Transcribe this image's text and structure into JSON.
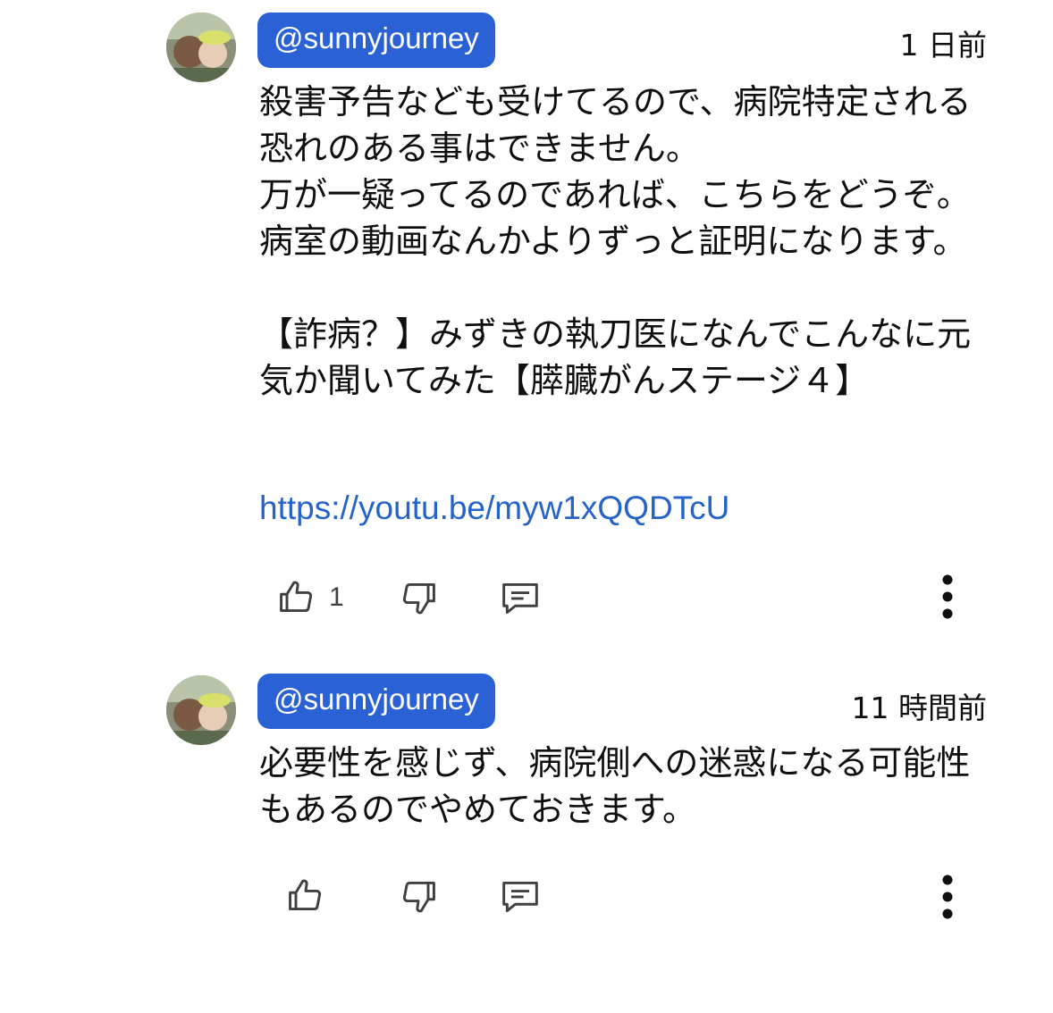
{
  "comments": [
    {
      "author": "@sunnyjourney",
      "time": "1 日前",
      "text": "殺害予告なども受けてるので、病院特定される恐れのある事はできません。\n万が一疑ってるのであれば、こちらをどうぞ。病室の動画なんかよりずっと証明になります。\n\n【詐病？】みずきの執刀医になんでこんなに元気か聞いてみた【膵臓がんステージ４】",
      "link": "https://youtu.be/myw1xQQDTcU",
      "like_count": "1",
      "icons": [
        "thumbs-up-icon",
        "thumbs-down-icon",
        "reply-icon",
        "more-vert-icon"
      ]
    },
    {
      "author": "@sunnyjourney",
      "time": "11 時間前",
      "text": "必要性を感じず、病院側への迷惑になる可能性もあるのでやめておきます。",
      "icons": [
        "thumbs-up-icon",
        "thumbs-down-icon",
        "reply-icon",
        "more-vert-icon"
      ]
    }
  ],
  "colors": {
    "handle_bg": "#2a62d6",
    "link": "#2563c9",
    "text": "#0f0f0f",
    "icon": "#404040"
  }
}
